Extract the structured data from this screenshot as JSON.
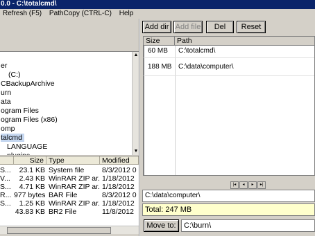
{
  "window": {
    "title": "0.0 - C:\\totalcmd\\"
  },
  "menu": {
    "items": [
      "Refresh (F5)",
      "PathCopy (CTRL-C)",
      "Help"
    ]
  },
  "tree": {
    "items": [
      {
        "label": "er"
      },
      {
        "label": "(C:)"
      },
      {
        "label": "CBackupArchive"
      },
      {
        "label": "urn"
      },
      {
        "label": "ata"
      },
      {
        "label": "ogram Files"
      },
      {
        "label": "ogram Files (x86)"
      },
      {
        "label": "omp"
      },
      {
        "label": "talcmd"
      },
      {
        "label": "LANGUAGE"
      },
      {
        "label": "plugins"
      }
    ]
  },
  "filelist": {
    "columns": {
      "size": "Size",
      "type": "Type",
      "modified": "Modified"
    },
    "rows": [
      {
        "name": "S...",
        "size": "23.1 KB",
        "type": "System file",
        "modified": "8/3/2012 0"
      },
      {
        "name": "V...",
        "size": "2.43 KB",
        "type": "WinRAR ZIP ar...",
        "modified": "1/18/2012"
      },
      {
        "name": "S...",
        "size": "4.71 KB",
        "type": "WinRAR ZIP ar...",
        "modified": "1/18/2012"
      },
      {
        "name": "R...",
        "size": "977 bytes",
        "type": "BAR File",
        "modified": "8/3/2012 0"
      },
      {
        "name": "S...",
        "size": "1.25 KB",
        "type": "WinRAR ZIP ar...",
        "modified": "1/18/2012"
      },
      {
        "name": "",
        "size": "43.83 KB",
        "type": "BR2 File",
        "modified": "11/8/2012"
      }
    ]
  },
  "toolbar": {
    "add_dir": "Add dir",
    "add_file": "Add file",
    "del": "Del",
    "reset": "Reset"
  },
  "grid": {
    "columns": {
      "size": "Size",
      "path": "Path"
    },
    "rows": [
      {
        "size": "60 MB",
        "path": "C:\\totalcmd\\"
      },
      {
        "size": "188 MB",
        "path": "C:\\data\\computer\\"
      }
    ]
  },
  "nav": [
    "|◂",
    "◂",
    "▸",
    "▸|"
  ],
  "current_path": "C:\\data\\computer\\",
  "total": "Total: 247 MB",
  "move": {
    "label": "Move to:",
    "value": "C:\\burn\\"
  }
}
